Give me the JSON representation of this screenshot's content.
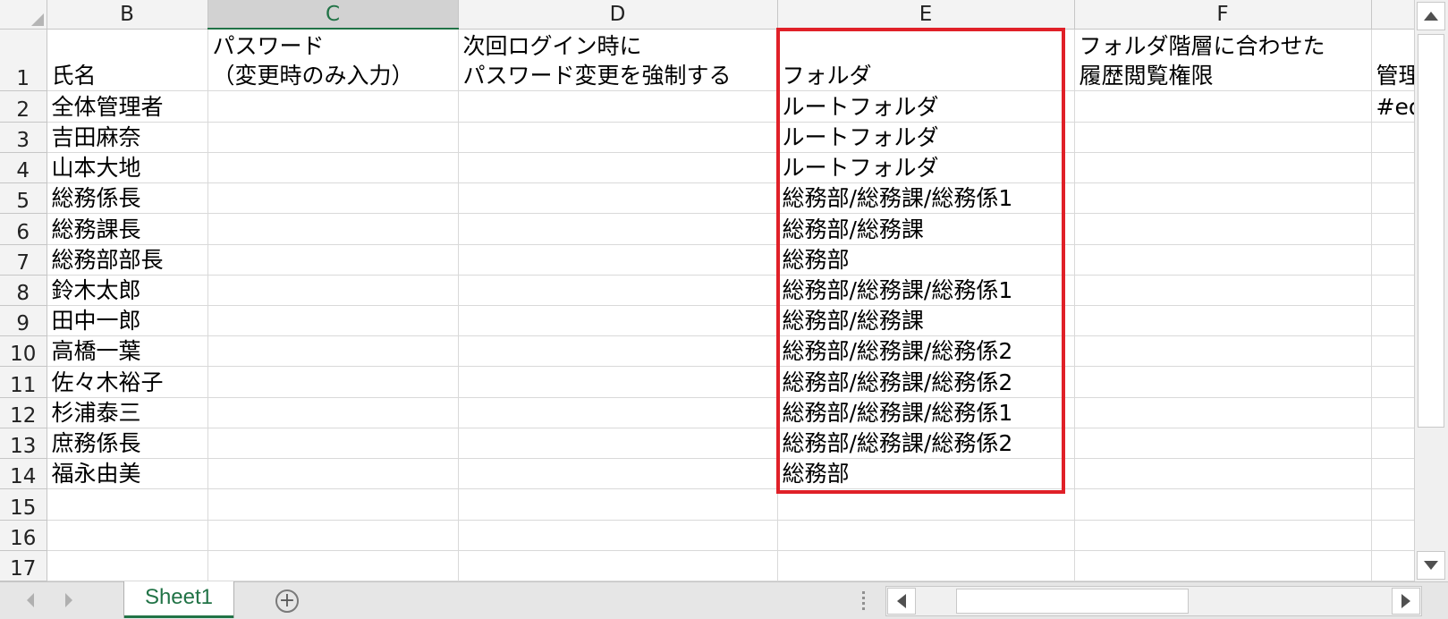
{
  "columns": [
    {
      "key": "B",
      "label": "B"
    },
    {
      "key": "C",
      "label": "C"
    },
    {
      "key": "D",
      "label": "D"
    },
    {
      "key": "E",
      "label": "E"
    },
    {
      "key": "F",
      "label": "F"
    },
    {
      "key": "G",
      "label": ""
    }
  ],
  "selected_column": "C",
  "header_row": {
    "row": "1",
    "B": "氏名",
    "C": "パスワード\n（変更時のみ入力）",
    "D": "次回ログイン時に\nパスワード変更を強制する",
    "E": "フォルダ",
    "F": "フォルダ階層に合わせた\n履歴閲覧権限",
    "G": "管理"
  },
  "rows": [
    {
      "row": "2",
      "B": "全体管理者",
      "E": "ルートフォルダ",
      "G": "#ed"
    },
    {
      "row": "3",
      "B": "吉田麻奈",
      "E": "ルートフォルダ"
    },
    {
      "row": "4",
      "B": "山本大地",
      "E": "ルートフォルダ"
    },
    {
      "row": "5",
      "B": "総務係長",
      "E": "総務部/総務課/総務係1"
    },
    {
      "row": "6",
      "B": "総務課長",
      "E": "総務部/総務課"
    },
    {
      "row": "7",
      "B": "総務部部長",
      "E": "総務部"
    },
    {
      "row": "8",
      "B": "鈴木太郎",
      "E": "総務部/総務課/総務係1"
    },
    {
      "row": "9",
      "B": "田中一郎",
      "E": "総務部/総務課"
    },
    {
      "row": "10",
      "B": "高橋一葉",
      "E": "総務部/総務課/総務係2"
    },
    {
      "row": "11",
      "B": "佐々木裕子",
      "E": "総務部/総務課/総務係2"
    },
    {
      "row": "12",
      "B": "杉浦泰三",
      "E": "総務部/総務課/総務係1"
    },
    {
      "row": "13",
      "B": "庶務係長",
      "E": "総務部/総務課/総務係2"
    },
    {
      "row": "14",
      "B": "福永由美",
      "E": "総務部"
    },
    {
      "row": "15"
    },
    {
      "row": "16"
    },
    {
      "row": "17"
    }
  ],
  "sheet_tab": {
    "label": "Sheet1"
  },
  "add_sheet_symbol": "+",
  "colors": {
    "accent": "#217346",
    "highlight": "#e02028"
  }
}
